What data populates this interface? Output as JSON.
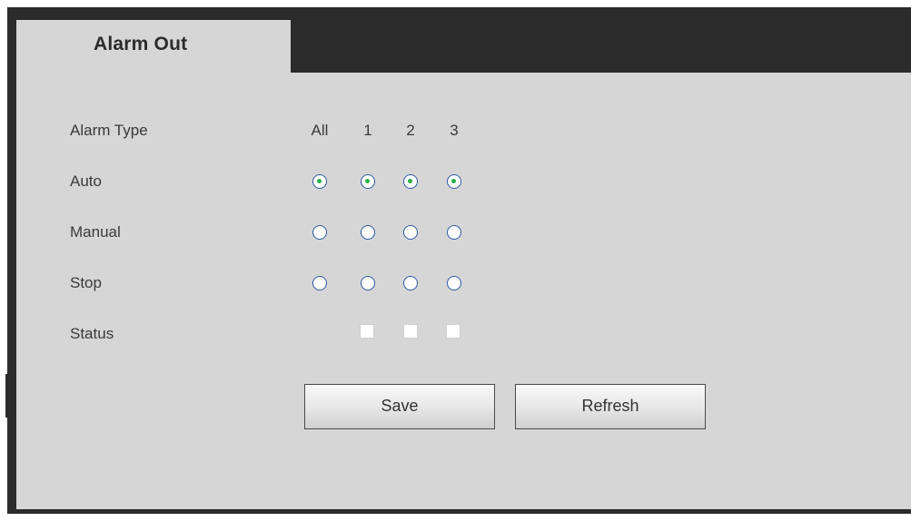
{
  "tab": {
    "label": "Alarm Out"
  },
  "header_row": {
    "label": "Alarm Type",
    "columns": [
      "All",
      "1",
      "2",
      "3"
    ]
  },
  "rows": {
    "auto": {
      "label": "Auto",
      "checked": [
        true,
        true,
        true,
        true
      ]
    },
    "manual": {
      "label": "Manual",
      "checked": [
        false,
        false,
        false,
        false
      ]
    },
    "stop": {
      "label": "Stop",
      "checked": [
        false,
        false,
        false,
        false
      ]
    },
    "status": {
      "label": "Status"
    }
  },
  "buttons": {
    "save": "Save",
    "refresh": "Refresh"
  },
  "colors": {
    "frame": "#2b2b2b",
    "panel": "#d6d6d6",
    "radio_border": "#2d58a7",
    "radio_dot": "#26b24a"
  }
}
